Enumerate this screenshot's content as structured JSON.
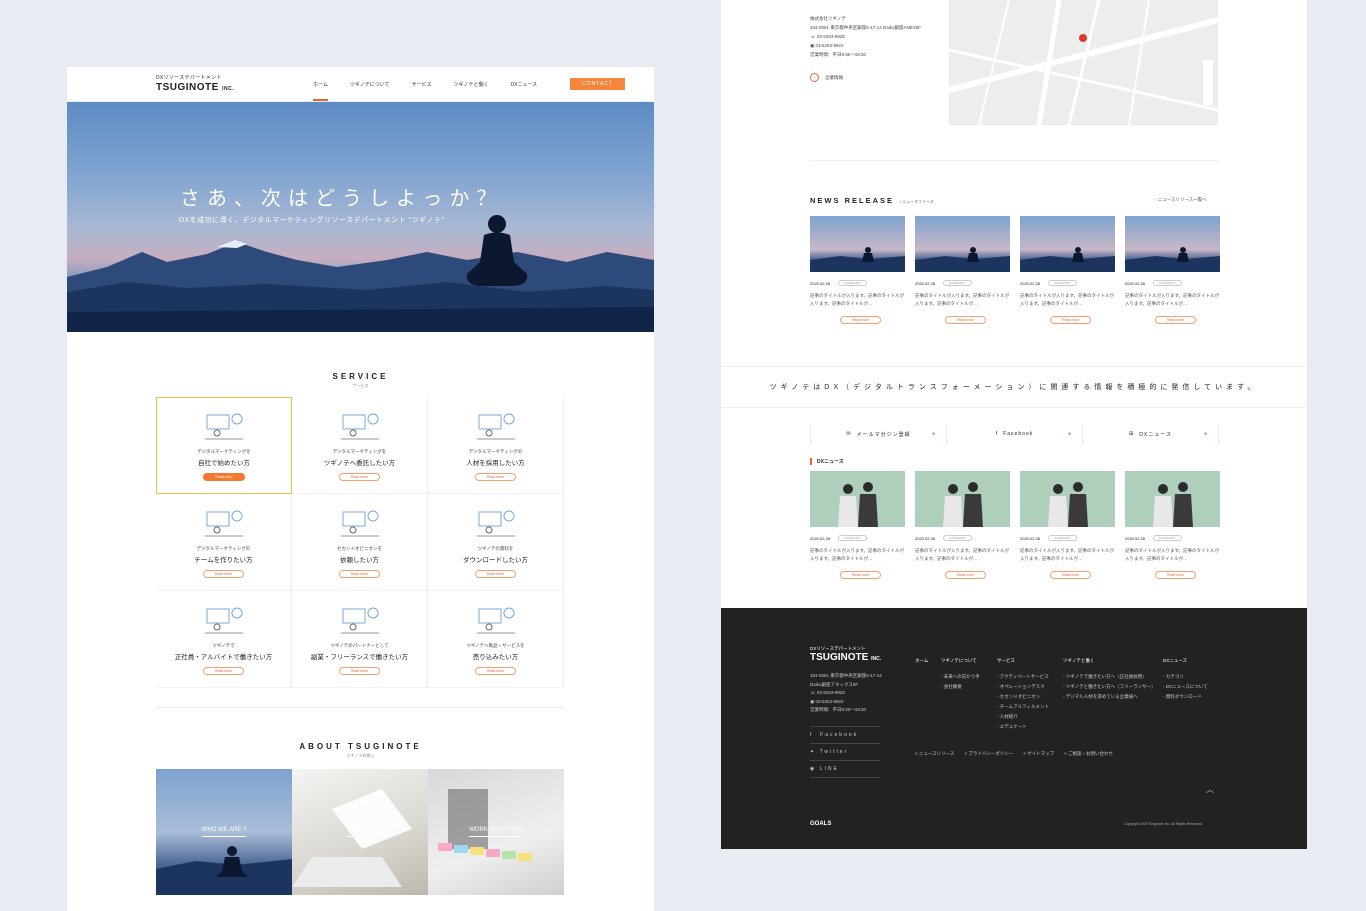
{
  "header": {
    "logo_sub": "DXリソースデパートメント",
    "logo_main": "TSUGINOTE",
    "logo_inc": "INC.",
    "nav": [
      "ホーム",
      "ツギノテについて",
      "サービス",
      "ツギノテと働く",
      "DXニュース"
    ],
    "contact": "CONTACT"
  },
  "hero": {
    "title": "さあ、次はどうしよっか？",
    "subtitle": "DXを成功に導く、デジタルマーケティングリソースデパートメント \"ツギノテ\""
  },
  "service": {
    "title": "SERVICE",
    "sub": "サービス",
    "items": [
      {
        "l1": "デジタルマーケティングを",
        "l2": "自社で始めたい方",
        "btn": "Read more"
      },
      {
        "l1": "デジタルマーケティングを",
        "l2": "ツギノテへ委託したい方",
        "btn": "Read more"
      },
      {
        "l1": "デジタルマーケティングの",
        "l2": "人材を採用したい方",
        "btn": "Read more"
      },
      {
        "l1": "デジタルマーケティングの",
        "l2": "チームを作りたい方",
        "btn": "Read more"
      },
      {
        "l1": "セカンドオピニオンを",
        "l2": "依頼したい方",
        "btn": "Read more"
      },
      {
        "l1": "ツギノテの資料を",
        "l2": "ダウンロードしたい方",
        "btn": "Read more"
      },
      {
        "l1": "ツギノテで",
        "l2": "正社員・アルバイトで働きたい方",
        "btn": "Read more"
      },
      {
        "l1": "ツギノテのパートナーとして",
        "l2": "副業・フリーランスで働きたい方",
        "btn": "Read more"
      },
      {
        "l1": "ツギノテへ製品・サービスを",
        "l2": "売り込みたい方",
        "btn": "Read more"
      }
    ]
  },
  "about": {
    "title": "ABOUT TSUGINOTE",
    "sub": "ツギノテの想い",
    "panels": [
      "WHO WE ARE ?",
      "SERVICE",
      "WORK TOGETHER"
    ]
  },
  "company": {
    "name": "株式会社ツギノテ",
    "address": "104-0061 東京都中央区銀座6-17-14 Daiko銀座ANEX5F",
    "tel": "03-6263-9926",
    "fax": "03-6263-9922",
    "hours": "営業時間：平日9:30〜18:30",
    "link": "企業情報"
  },
  "news": {
    "title": "NEWS RELEASE",
    "sub": "ニュースリリース",
    "more": "ニュースリリース一覧へ",
    "items": [
      {
        "date": "2020.02.28",
        "tag": "CATEGORY",
        "text": "記事のタイトルが入ります。記事のタイトルが入ります。記事のタイトルが…",
        "btn": "Read more"
      },
      {
        "date": "2020.02.28",
        "tag": "CATEGORY",
        "text": "記事のタイトルが入ります。記事のタイトルが入ります。記事のタイトルが…",
        "btn": "Read more"
      },
      {
        "date": "2020.02.28",
        "tag": "CATEGORY",
        "text": "記事のタイトルが入ります。記事のタイトルが入ります。記事のタイトルが…",
        "btn": "Read more"
      },
      {
        "date": "2020.02.28",
        "tag": "CATEGORY",
        "text": "記事のタイトルが入ります。記事のタイトルが入ります。記事のタイトルが…",
        "btn": "Read more"
      }
    ]
  },
  "banner": "ツギノテはDX（デジタルトランスフォーメーション）に関連する情報を積極的に発信しています。",
  "links": [
    "メールマガジン登録",
    "Facebook",
    "DXニュース"
  ],
  "dx_news": {
    "title": "DXニュース",
    "items": [
      {
        "date": "2020.02.28",
        "tag": "CATEGORY",
        "text": "記事のタイトルが入ります。記事のタイトルが入ります。記事のタイトルが…",
        "btn": "Read more"
      },
      {
        "date": "2020.02.28",
        "tag": "CATEGORY",
        "text": "記事のタイトルが入ります。記事のタイトルが入ります。記事のタイトルが…",
        "btn": "Read more"
      },
      {
        "date": "2020.02.28",
        "tag": "CATEGORY",
        "text": "記事のタイトルが入ります。記事のタイトルが入ります。記事のタイトルが…",
        "btn": "Read more"
      },
      {
        "date": "2020.02.28",
        "tag": "CATEGORY",
        "text": "記事のタイトルが入ります。記事のタイトルが入ります。記事のタイトルが…",
        "btn": "Read more"
      }
    ]
  },
  "footer": {
    "logo_sub": "DXリソースデパートメント",
    "logo_main": "TSUGINOTE",
    "logo_inc": "INC.",
    "address1": "104-0061 東京都中央区銀座6-17-14",
    "address2": "Daiko銀座アネックス5F",
    "tel": "03-6263-9926",
    "fax": "03-6263-9922",
    "hours": "営業時間：平日9:30〜18:30",
    "social": [
      "Facebook",
      "Twitter",
      "LINE"
    ],
    "cols": [
      {
        "h": "ホーム",
        "items": []
      },
      {
        "h": "ツギノテについて",
        "items": [
          "- 未来への向かう手",
          "- 会社概要"
        ]
      },
      {
        "h": "サービス",
        "items": [
          "- アクティベートサービス",
          "- オペレーションデスク",
          "- セカンドオピニオン",
          "- チームアルフィルメント",
          "- 人材紹介",
          "- エデュケート"
        ]
      },
      {
        "h": "ツギノテと働く",
        "items": [
          "- ツギノテで働きたい方へ（正社員採用）",
          "- ツギノテと働きたい方へ（フリーランサー）",
          "- デジマル人材を求めている企業様へ"
        ]
      },
      {
        "h": "DXニュース",
        "items": [
          "- カテゴリ",
          "- DXニュースについて",
          "- 資料ダウンロード"
        ]
      }
    ],
    "bottom_links": [
      "> ニュースリリース",
      "> プライバシーポリシー",
      "> サイトマップ",
      "> ご相談・お問い合わせ"
    ],
    "sdgs": "GOALS",
    "copyright": "Copyright 2020 Tsuginote Inc. All Rights Reserved."
  }
}
